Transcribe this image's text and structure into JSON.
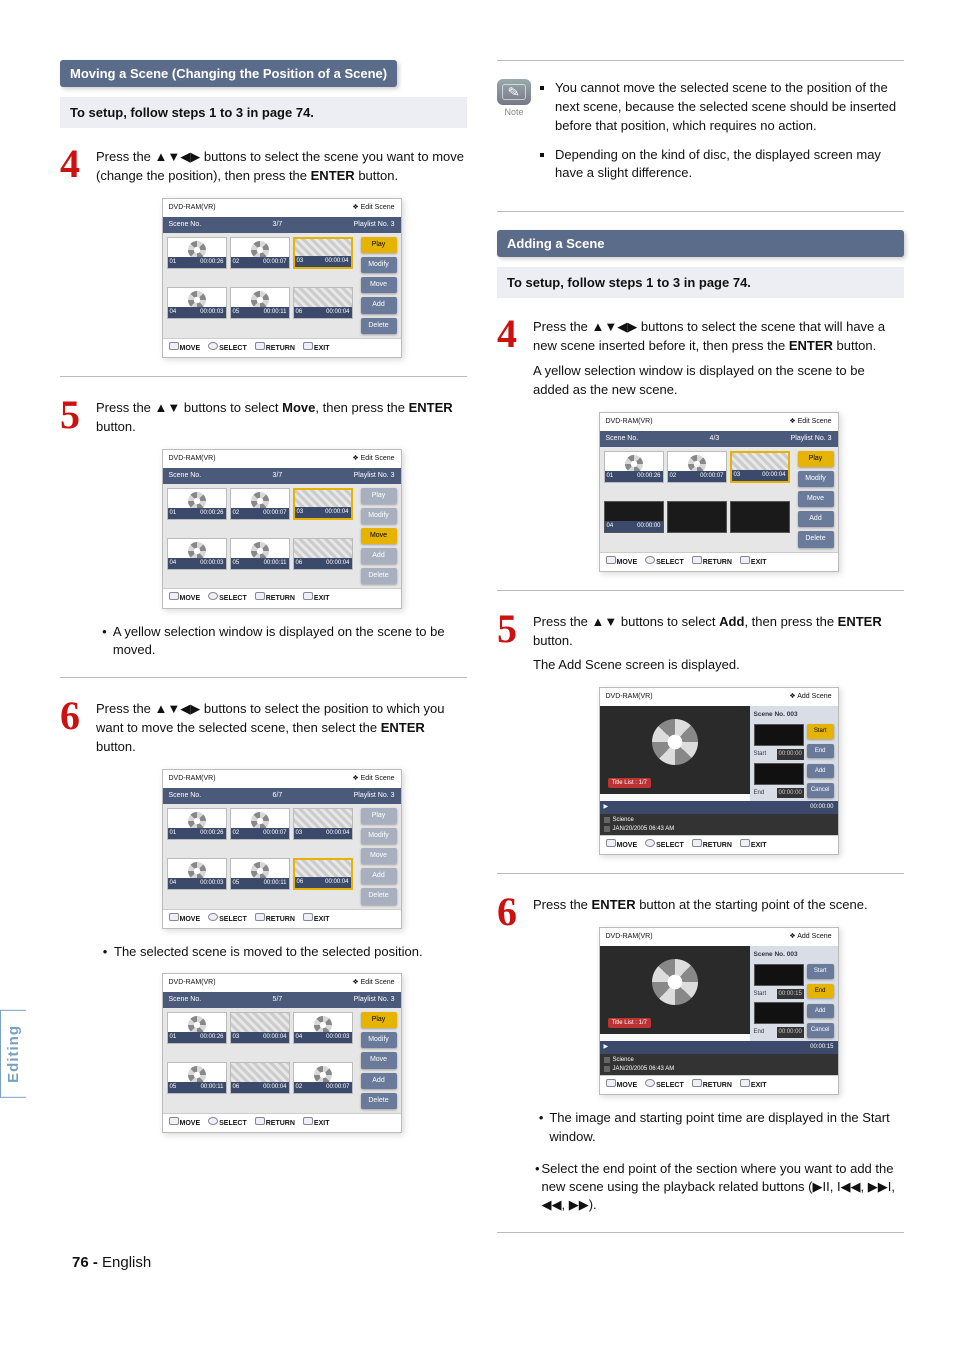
{
  "left": {
    "header": "Moving a Scene (Changing the Position of a Scene)",
    "setup": "To setup, follow steps 1 to 3 in page 74.",
    "step4": {
      "text": "Press the ▲▼◀▶ buttons to select the scene you want to move (change the position), then press the ",
      "enter": "ENTER",
      "suffix": " button."
    },
    "device1": {
      "title_left": "DVD-RAM(VR)",
      "title_right": "Edit Scene",
      "bar_left": "Scene No.",
      "bar_mid": "3/7",
      "bar_right": "Playlist No.   3",
      "thumbs": [
        {
          "n": "01",
          "t": "00:00:26"
        },
        {
          "n": "02",
          "t": "00:00:07"
        },
        {
          "n": "03",
          "t": "00:00:04",
          "yellow": true,
          "tex": true
        },
        {
          "n": "04",
          "t": "00:00:03"
        },
        {
          "n": "05",
          "t": "00:00:11"
        },
        {
          "n": "06",
          "t": "00:00:04",
          "tex": true
        }
      ],
      "side": [
        {
          "label": "Play",
          "hl": true
        },
        {
          "label": "Modify"
        },
        {
          "label": "Move"
        },
        {
          "label": "Add"
        },
        {
          "label": "Delete"
        }
      ],
      "footer": [
        "MOVE",
        "SELECT",
        "RETURN",
        "EXIT"
      ]
    },
    "step5": {
      "pre": "Press the ▲▼ buttons to select ",
      "bold": "Move",
      "mid": ", then press the ",
      "enter": "ENTER",
      "suffix": " button."
    },
    "device2": {
      "title_left": "DVD-RAM(VR)",
      "title_right": "Edit Scene",
      "bar_left": "Scene No.",
      "bar_mid": "3/7",
      "bar_right": "Playlist No.   3",
      "thumbs": [
        {
          "n": "01",
          "t": "00:00:26"
        },
        {
          "n": "02",
          "t": "00:00:07"
        },
        {
          "n": "03",
          "t": "00:00:04",
          "yellow": true,
          "tex": true
        },
        {
          "n": "04",
          "t": "00:00:03"
        },
        {
          "n": "05",
          "t": "00:00:11"
        },
        {
          "n": "06",
          "t": "00:00:04",
          "tex": true
        }
      ],
      "side": [
        {
          "label": "Play",
          "inactive": true
        },
        {
          "label": "Modify",
          "inactive": true
        },
        {
          "label": "Move",
          "hl": true
        },
        {
          "label": "Add",
          "inactive": true
        },
        {
          "label": "Delete",
          "inactive": true
        }
      ],
      "footer": [
        "MOVE",
        "SELECT",
        "RETURN",
        "EXIT"
      ]
    },
    "bullet5": "A yellow selection window is displayed on the scene to be moved.",
    "step6": {
      "pre": "Press the ▲▼◀▶ buttons to select the position to which you want to move the selected scene, then select the ",
      "enter": "ENTER",
      "suffix": " button."
    },
    "device3": {
      "title_left": "DVD-RAM(VR)",
      "title_right": "Edit Scene",
      "bar_left": "Scene No.",
      "bar_mid": "6/7",
      "bar_right": "Playlist No.   3",
      "thumbs": [
        {
          "n": "01",
          "t": "00:00:26"
        },
        {
          "n": "02",
          "t": "00:00:07"
        },
        {
          "n": "03",
          "t": "00:00:04",
          "tex": true
        },
        {
          "n": "04",
          "t": "00:00:03"
        },
        {
          "n": "05",
          "t": "00:00:11"
        },
        {
          "n": "06",
          "t": "00:00:04",
          "yellow": true,
          "tex": true
        }
      ],
      "side": [
        {
          "label": "Play",
          "inactive": true
        },
        {
          "label": "Modify",
          "inactive": true
        },
        {
          "label": "Move",
          "inactive": true
        },
        {
          "label": "Add",
          "inactive": true
        },
        {
          "label": "Delete",
          "inactive": true
        }
      ],
      "footer": [
        "MOVE",
        "SELECT",
        "RETURN",
        "EXIT"
      ]
    },
    "bullet6": "The selected scene is moved to the selected position.",
    "device4": {
      "title_left": "DVD-RAM(VR)",
      "title_right": "Edit Scene",
      "bar_left": "Scene No.",
      "bar_mid": "5/7",
      "bar_right": "Playlist No.   3",
      "thumbs": [
        {
          "n": "01",
          "t": "00:00:26"
        },
        {
          "n": "03",
          "t": "00:00:04",
          "tex": true
        },
        {
          "n": "04",
          "t": "00:00:03"
        },
        {
          "n": "05",
          "t": "00:00:11"
        },
        {
          "n": "06",
          "t": "00:00:04",
          "tex": true
        },
        {
          "n": "02",
          "t": "00:00:07"
        }
      ],
      "side": [
        {
          "label": "Play",
          "hl": true
        },
        {
          "label": "Modify"
        },
        {
          "label": "Move"
        },
        {
          "label": "Add"
        },
        {
          "label": "Delete"
        }
      ],
      "footer": [
        "MOVE",
        "SELECT",
        "RETURN",
        "EXIT"
      ]
    }
  },
  "right": {
    "note_label": "Note",
    "note1": "You cannot move the selected scene to the position of the next scene, because the selected scene should be inserted before that position, which requires no action.",
    "note2": "Depending on the kind of disc, the displayed screen may have a slight difference.",
    "header": "Adding a Scene",
    "setup": "To setup, follow steps 1 to 3 in page 74.",
    "step4": {
      "pre": "Press the ▲▼◀▶ buttons to select the scene that will have a new scene inserted before it, then press the ",
      "enter": "ENTER",
      "suffix": " button."
    },
    "step4_tail": "A yellow selection window is displayed on the scene to be added as the new scene.",
    "device1": {
      "title_left": "DVD-RAM(VR)",
      "title_right": "Edit Scene",
      "bar_left": "Scene No.",
      "bar_mid": "4/3",
      "bar_right": "Playlist No.   3",
      "thumbs": [
        {
          "n": "01",
          "t": "00:00:26"
        },
        {
          "n": "02",
          "t": "00:00:07"
        },
        {
          "n": "03",
          "t": "00:00:04",
          "yellow": true,
          "tex": true
        },
        {
          "n": "04",
          "t": "00:00:00",
          "dark": true
        },
        {
          "n": "",
          "t": "",
          "dark": true
        },
        {
          "n": "",
          "t": "",
          "dark": true
        }
      ],
      "side": [
        {
          "label": "Play",
          "hl": true
        },
        {
          "label": "Modify"
        },
        {
          "label": "Move"
        },
        {
          "label": "Add"
        },
        {
          "label": "Delete"
        }
      ],
      "footer": [
        "MOVE",
        "SELECT",
        "RETURN",
        "EXIT"
      ]
    },
    "step5": {
      "pre": "Press the ▲▼ buttons to select ",
      "bold": "Add",
      "mid": ", then press the ",
      "enter": "ENTER",
      "suffix": " button."
    },
    "step5_tail": "The Add Scene screen is displayed.",
    "device2": {
      "title_left": "DVD-RAM(VR)",
      "title_right": "Add Scene",
      "scene_no": "Scene No. 003",
      "title_tag": "Title List : 1/7",
      "playbar_time": "00:00:00",
      "meta_name": "Science",
      "meta_date": "JAN/20/2005 06:43 AM",
      "start_time": "00:00:00",
      "end_time": "00:00:00",
      "side": [
        {
          "label": "Start",
          "hl": true
        },
        {
          "label": "End"
        },
        {
          "label": "Add"
        },
        {
          "label": "Cancel"
        }
      ],
      "footer": [
        "MOVE",
        "SELECT",
        "RETURN",
        "EXIT"
      ]
    },
    "step6": {
      "pre": "Press the ",
      "enter": "ENTER",
      "suffix": " button at the starting point of the scene."
    },
    "device3": {
      "title_left": "DVD-RAM(VR)",
      "title_right": "Add Scene",
      "scene_no": "Scene No. 003",
      "title_tag": "Title List : 1/7",
      "playbar_time": "00:00:15",
      "meta_name": "Science",
      "meta_date": "JAN/20/2005 06:43 AM",
      "start_time": "00:00:15",
      "end_time": "00:00:00",
      "side": [
        {
          "label": "Start"
        },
        {
          "label": "End",
          "hl": true
        },
        {
          "label": "Add"
        },
        {
          "label": "Cancel"
        }
      ],
      "footer": [
        "MOVE",
        "SELECT",
        "RETURN",
        "EXIT"
      ]
    },
    "bullet6a": "The image and starting point time are displayed in the Start window.",
    "bullet6b": "Select the end point of the section where you want to add the new scene using the playback related buttons (▶II, I◀◀, ▶▶I, ◀◀, ▶▶)."
  },
  "sidebar": "Editing",
  "page": {
    "num": "76 -",
    "lang": "English"
  }
}
